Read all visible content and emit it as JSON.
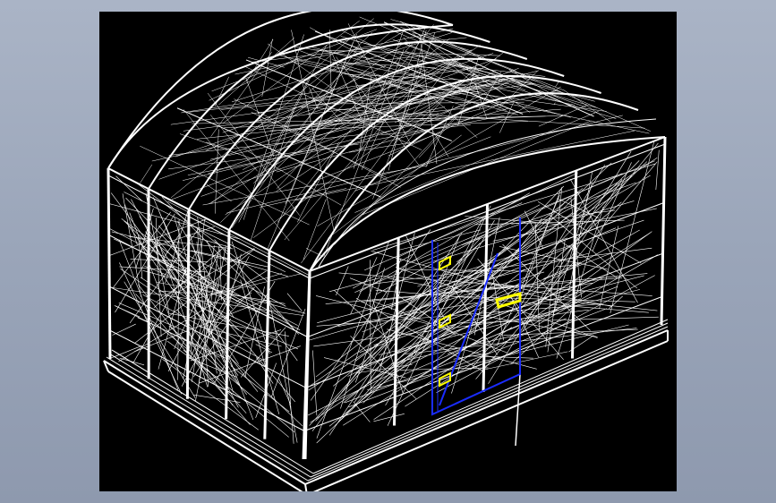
{
  "viewer": {
    "background": "#000000",
    "frame_background": "#9ea9bc"
  },
  "model": {
    "kind": "wireframe",
    "subject": "arched-roof-greenhouse",
    "line_color": "#ffffff",
    "door_color": "#1a2cff",
    "hardware_color": "#ffff00",
    "bays": 5
  }
}
